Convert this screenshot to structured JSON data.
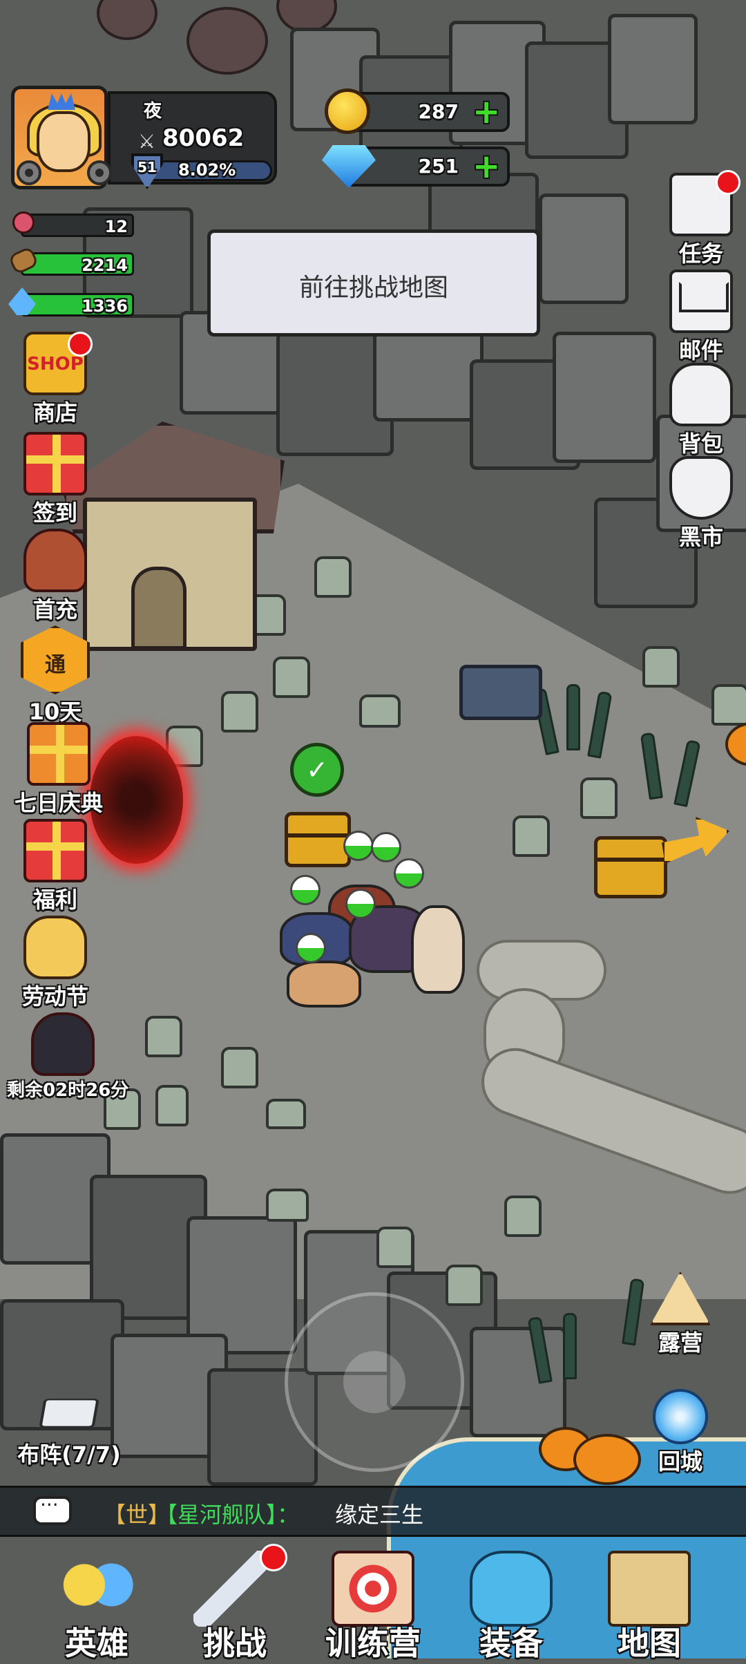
{
  "player": {
    "name": "夜",
    "power": "80062",
    "level": "51",
    "exp_percent": "8.02%"
  },
  "currency": {
    "gold": "287",
    "diamonds": "251"
  },
  "resources": {
    "meat": "12",
    "wood": "2214",
    "crystal": "1336"
  },
  "task_banner": "前往挑战地图",
  "left_menu": [
    {
      "label": "商店",
      "icon": "shop-icon",
      "badge": true,
      "icon_text": "SHOP"
    },
    {
      "label": "签到",
      "icon": "gift-icon"
    },
    {
      "label": "首充",
      "icon": "character-icon"
    },
    {
      "label": "10天",
      "icon": "pass-icon",
      "icon_text": "通"
    },
    {
      "label": "七日庆典",
      "icon": "gift-box-icon"
    },
    {
      "label": "福利",
      "icon": "gift-icon"
    },
    {
      "label": "劳动节",
      "icon": "bag-icon"
    },
    {
      "label": "剩余02时26分",
      "icon": "character-icon"
    }
  ],
  "right_menu": [
    {
      "label": "任务",
      "icon": "task-scroll-icon",
      "badge": true
    },
    {
      "label": "邮件",
      "icon": "mail-icon"
    },
    {
      "label": "背包",
      "icon": "backpack-icon"
    },
    {
      "label": "黑市",
      "icon": "sack-icon"
    }
  ],
  "map_actions": {
    "formation": "布阵(7/7)",
    "camp": "露营",
    "return_city": "回城"
  },
  "chat": {
    "channel": "【世】",
    "sender": "【星河舰队】：",
    "message": "缘定三生"
  },
  "bottom_nav": [
    {
      "label": "英雄",
      "icon": "heroes-icon"
    },
    {
      "label": "挑战",
      "icon": "sword-icon",
      "badge": true
    },
    {
      "label": "训练营",
      "icon": "target-icon"
    },
    {
      "label": "装备",
      "icon": "armor-icon"
    },
    {
      "label": "地图",
      "icon": "map-icon"
    }
  ],
  "colors": {
    "accent_green": "#3fdc2a",
    "badge_red": "#e8141a",
    "chat_channel": "#e8b84a",
    "chat_sender": "#3fdc5a"
  }
}
